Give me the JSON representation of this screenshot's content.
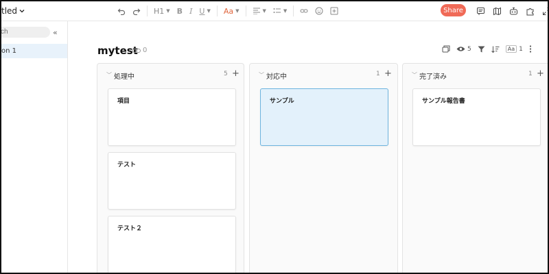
{
  "document": {
    "title": "tled"
  },
  "toolbar": {
    "heading_label": "H1",
    "bold_label": "B",
    "italic_label": "I",
    "underline_label": "U",
    "text_color_label": "Aa",
    "text_color": "#e0643b",
    "share_label": "Share",
    "share_color": "#f06a57"
  },
  "sidebar": {
    "search_placeholder": "ch",
    "items": [
      {
        "label": "on 1",
        "selected": true
      }
    ]
  },
  "page": {
    "title": "mytest",
    "link_count": "0",
    "view_count": "5",
    "font_size_label": "Aa",
    "font_size_value": "1"
  },
  "board": {
    "columns": [
      {
        "name": "処理中",
        "count": "5",
        "cards": [
          {
            "title": "項目"
          },
          {
            "title": "テスト"
          },
          {
            "title": "テスト２"
          }
        ]
      },
      {
        "name": "対応中",
        "count": "1",
        "cards": [
          {
            "title": "サンプル",
            "selected": true
          }
        ]
      },
      {
        "name": "完了済み",
        "count": "1",
        "cards": [
          {
            "title": "サンプル報告書"
          }
        ]
      }
    ]
  },
  "colors": {
    "selected_bg": "#e3f1fb",
    "selected_border": "#6cb3de",
    "sidebar_selected_bg": "#e8f2fb"
  }
}
